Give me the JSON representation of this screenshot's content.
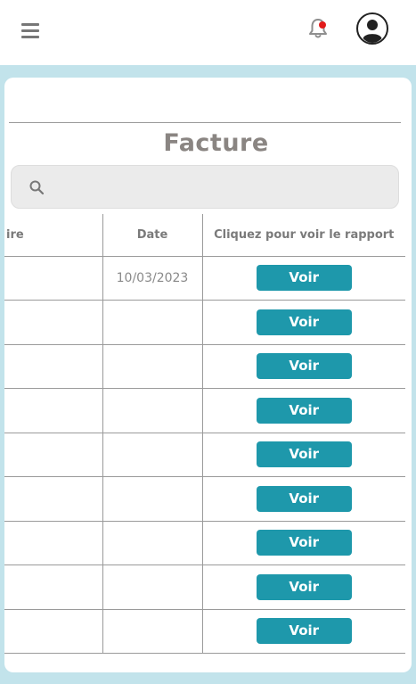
{
  "header": {
    "menu_icon": "hamburger-menu-icon",
    "notification_icon": "bell-icon",
    "notification_badge_color": "#e21b1b",
    "profile_icon": "user-avatar-icon"
  },
  "page": {
    "title": "Facture"
  },
  "search": {
    "icon": "search-icon",
    "placeholder": "",
    "value": ""
  },
  "table": {
    "columns": [
      "ire",
      "Date",
      "Cliquez pour voir le rapport"
    ],
    "rows": [
      {
        "col1": "",
        "date": "10/03/2023",
        "action": "Voir"
      },
      {
        "col1": "",
        "date": "",
        "action": "Voir"
      },
      {
        "col1": "",
        "date": "",
        "action": "Voir"
      },
      {
        "col1": "",
        "date": "",
        "action": "Voir"
      },
      {
        "col1": "",
        "date": "",
        "action": "Voir"
      },
      {
        "col1": "",
        "date": "",
        "action": "Voir"
      },
      {
        "col1": "",
        "date": "",
        "action": "Voir"
      },
      {
        "col1": "",
        "date": "",
        "action": "Voir"
      },
      {
        "col1": "",
        "date": "",
        "action": "Voir"
      }
    ]
  },
  "colors": {
    "accent": "#1e98ab",
    "background": "#c2e3eb",
    "title": "#8a8582"
  }
}
